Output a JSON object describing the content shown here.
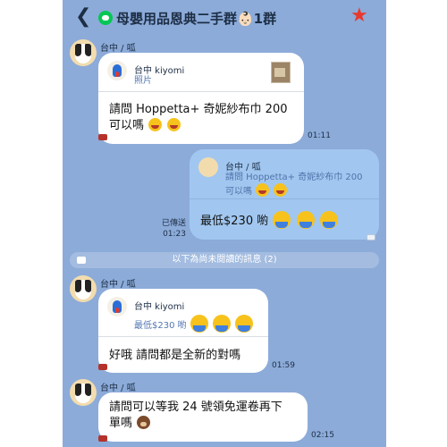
{
  "header": {
    "back_icon": "chevron-left-icon",
    "title": "母嬰用品恩典二手群👶🏻1群",
    "star_icon": "star-icon",
    "star_color": "#e8392c"
  },
  "messages": [
    {
      "sender": "台中 / 呱",
      "quote_name": "台中 kiyomi",
      "quote_text": "照片",
      "text_line1": "請問 Hoppetta+ 奇妮紗布巾 200",
      "text_line2": "可以嗎",
      "time": "01:11"
    },
    {
      "quote_name": "台中 / 呱",
      "quote_line1": "請問 Hoppetta+ 奇妮紗布巾 200",
      "quote_line2": "可以嗎",
      "text": "最低$230 喲",
      "sent_label": "已傳送",
      "time": "01:23"
    },
    {
      "sender": "台中 / 呱",
      "quote_name": "台中 kiyomi",
      "quote_text": "最低$230 喲",
      "text": "好哦 請問都是全新的對嗎",
      "time": "01:59"
    },
    {
      "sender": "台中 / 呱",
      "text_line1": "請問可以等我 24 號領免運卷再下",
      "text_line2": "單嗎",
      "time": "02:15"
    }
  ],
  "divider": {
    "text": "以下為尚未閱讀的訊息 (2)"
  },
  "colors": {
    "chat_bg": "#8cabd9",
    "bubble_other": "#ffffff",
    "bubble_mine": "#a1c7f0"
  }
}
